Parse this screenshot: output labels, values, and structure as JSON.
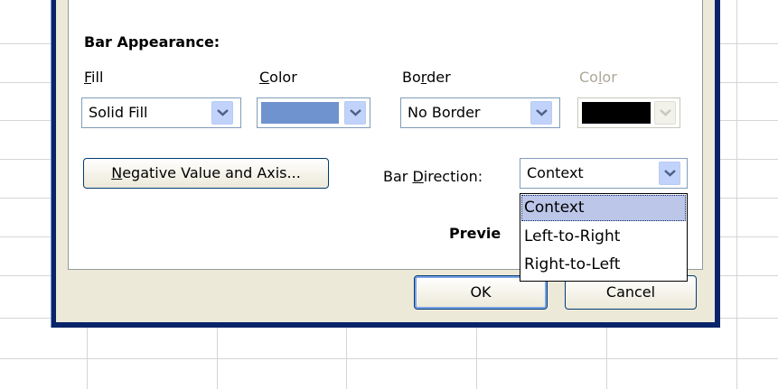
{
  "section_title": "Bar Appearance:",
  "fill": {
    "label_prefix": "F",
    "label_rest": "ill",
    "value": "Solid Fill"
  },
  "color": {
    "label_prefix": "C",
    "label_rest": "olor",
    "swatch": "#6f93cf"
  },
  "border": {
    "label_prefix": "Bo",
    "label_ul": "r",
    "label_rest": "der",
    "value": "No Border"
  },
  "border_color": {
    "label_prefix": "Co",
    "label_ul": "l",
    "label_rest": "or",
    "swatch": "#000000"
  },
  "negative_button": {
    "label_ul": "N",
    "label_rest": "egative Value and Axis..."
  },
  "bar_direction": {
    "label_prefix": "Bar ",
    "label_ul": "D",
    "label_rest": "irection:",
    "value": "Context",
    "options": [
      "Context",
      "Left-to-Right",
      "Right-to-Left"
    ],
    "selected_index": 0
  },
  "preview_label": "Previe",
  "ok_label": "OK",
  "cancel_label": "Cancel",
  "colors": {
    "dialog_frame": "#0a246a",
    "dialog_face": "#ece9d8",
    "selection": "#bcc6e8"
  }
}
